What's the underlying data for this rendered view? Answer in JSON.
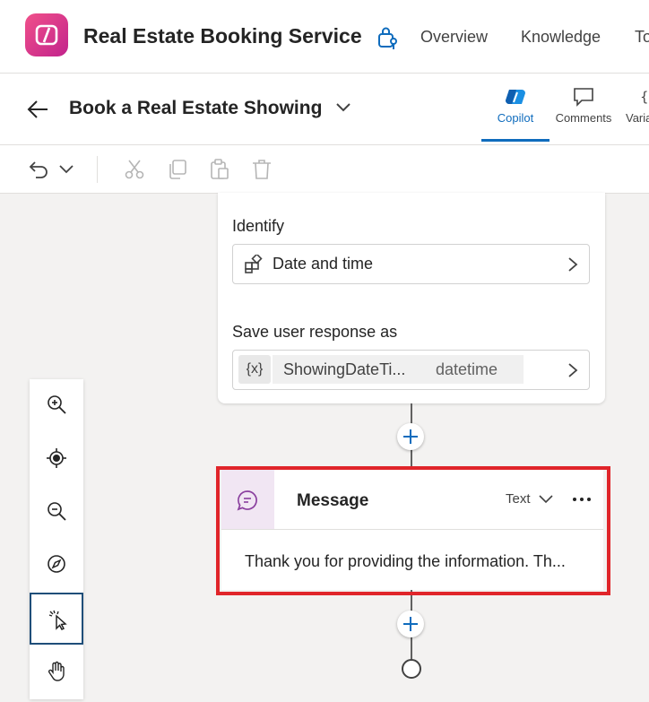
{
  "app": {
    "title": "Real Estate Booking Service",
    "nav": [
      "Overview",
      "Knowledge",
      "To"
    ]
  },
  "topic": {
    "title": "Book a Real Estate Showing",
    "tabs": [
      {
        "label": "Copilot",
        "active": true
      },
      {
        "label": "Comments",
        "active": false
      },
      {
        "label": "Varia",
        "active": false
      }
    ]
  },
  "question_card": {
    "identify_label": "Identify",
    "identify_value": "Date and time",
    "save_label": "Save user response as",
    "var_icon": "{x}",
    "var_name": "ShowingDateTi...",
    "var_type": "datetime"
  },
  "message_card": {
    "title": "Message",
    "kind": "Text",
    "text": "Thank you for providing the information. Th..."
  },
  "colors": {
    "accent": "#0f6cbd",
    "highlight": "#e0252a",
    "message_icon_bg": "#f1e6f3",
    "message_icon": "#8a3f9e"
  },
  "icons": {
    "side_tools": [
      "zoom-in-icon",
      "focus-icon",
      "zoom-out-icon",
      "minimap-icon",
      "select-pointer-icon",
      "pan-hand-icon"
    ],
    "toolbar": [
      "undo-icon",
      "chevron-down-icon",
      "cut-icon",
      "copy-icon",
      "paste-icon",
      "delete-icon"
    ]
  }
}
